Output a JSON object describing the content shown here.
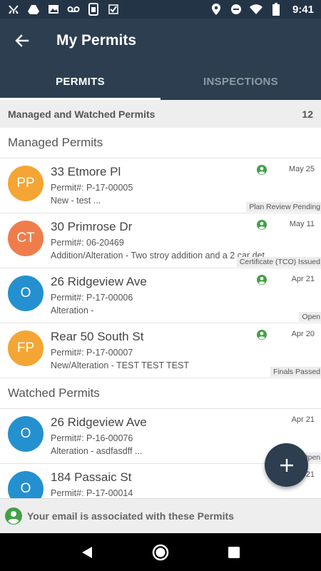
{
  "status_bar": {
    "time": "9:41",
    "left_icons": [
      "fork-icon",
      "drive-icon",
      "image-icon",
      "voicemail-icon",
      "sim-icon",
      "check-icon"
    ],
    "right_icons": [
      "location-icon",
      "do-not-disturb-icon",
      "wifi-icon",
      "battery-icon"
    ]
  },
  "app_bar": {
    "title": "My Permits"
  },
  "tabs": [
    {
      "label": "PERMITS",
      "active": true
    },
    {
      "label": "INSPECTIONS",
      "active": false
    }
  ],
  "summary": {
    "label": "Managed and Watched Permits",
    "count": "12"
  },
  "managed": {
    "header": "Managed Permits",
    "items": [
      {
        "initials": "PP",
        "color": "#f4a534",
        "address": "33 Etmore Pl",
        "permit": "Permit#: P-17-00005",
        "desc": "New - test ...",
        "date": "May 25",
        "status": "Plan Review Pending"
      },
      {
        "initials": "CT",
        "color": "#ef7d4c",
        "address": "30 Primrose Dr",
        "permit": "Permit#: 06-20469",
        "desc": "Addition/Alteration - Two stroy addition and a 2 car det...",
        "date": "May 11",
        "status": "Certificate (TCO) Issued"
      },
      {
        "initials": "O",
        "color": "#2490cf",
        "address": "26 Ridgeview Ave",
        "permit": "Permit#: P-17-00006",
        "desc": "Alteration -",
        "date": "Apr 21",
        "status": "Open"
      },
      {
        "initials": "FP",
        "color": "#f4a534",
        "address": "Rear 50 South St",
        "permit": "Permit#: P-17-00007",
        "desc": "New/Alteration - TEST TEST TEST",
        "date": "Apr 20",
        "status": "Finals Passed"
      }
    ]
  },
  "watched": {
    "header": "Watched Permits",
    "items": [
      {
        "initials": "O",
        "color": "#2490cf",
        "address": "26 Ridgeview Ave",
        "permit": "Permit#: P-16-00076",
        "desc": "Alteration - asdfasdff ...",
        "date": "Apr 21",
        "status": "Open"
      },
      {
        "initials": "O",
        "color": "#2490cf",
        "address": "184 Passaic St",
        "permit": "Permit#: P-17-00014",
        "desc": "",
        "date": "Apr 21",
        "status": ""
      }
    ]
  },
  "notice": {
    "text": "Your email is associated with these Permits"
  },
  "colors": {
    "primary": "#2c3e50",
    "status_bar": "#243447",
    "user_icon": "#43a047"
  }
}
